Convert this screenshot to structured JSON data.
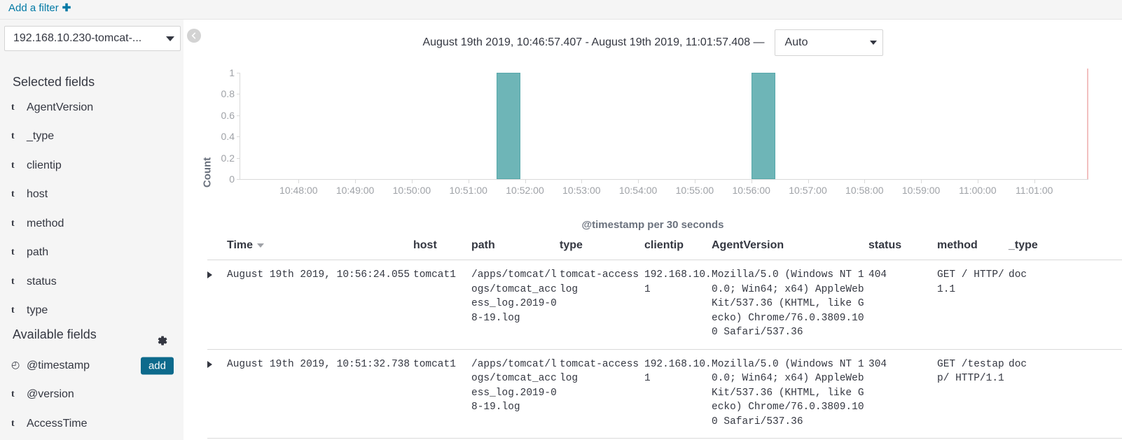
{
  "filter_bar": {
    "add_filter_label": "Add a filter",
    "plus_glyph": "✚"
  },
  "sidebar": {
    "index_pattern": "192.168.10.230-tomcat-...",
    "selected_fields_title": "Selected fields",
    "available_fields_title": "Available fields",
    "add_button_label": "add",
    "selected_fields": [
      {
        "type": "t",
        "name": "AgentVersion"
      },
      {
        "type": "t",
        "name": "_type"
      },
      {
        "type": "t",
        "name": "clientip"
      },
      {
        "type": "t",
        "name": "host"
      },
      {
        "type": "t",
        "name": "method"
      },
      {
        "type": "t",
        "name": "path"
      },
      {
        "type": "t",
        "name": "status"
      },
      {
        "type": "t",
        "name": "type"
      }
    ],
    "available_fields": [
      {
        "type": "⊘",
        "name": "@timestamp",
        "has_add": true
      },
      {
        "type": "t",
        "name": "@version",
        "has_add": false
      },
      {
        "type": "t",
        "name": "AccessTime",
        "has_add": false
      }
    ]
  },
  "toolbar": {
    "time_range": "August 19th 2019, 10:46:57.407 - August 19th 2019, 11:01:57.408 —",
    "interval": "Auto"
  },
  "chart_data": {
    "type": "bar",
    "title": "",
    "xlabel": "@timestamp per 30 seconds",
    "ylabel": "Count",
    "ylim": [
      0,
      1
    ],
    "yticks": [
      "1",
      "0.8",
      "0.6",
      "0.4",
      "0.2",
      "0"
    ],
    "ytick_values": [
      1,
      0.8,
      0.6,
      0.4,
      0.2,
      0
    ],
    "xticks": [
      "10:48:00",
      "10:49:00",
      "10:50:00",
      "10:51:00",
      "10:52:00",
      "10:53:00",
      "10:54:00",
      "10:55:00",
      "10:56:00",
      "10:57:00",
      "10:58:00",
      "10:59:00",
      "11:00:00",
      "11:01:00"
    ],
    "bars": [
      {
        "time": "10:51:30",
        "value": 1
      },
      {
        "time": "10:56:00",
        "value": 1
      }
    ],
    "bar_color": "#6eb5b7",
    "now_marker_color": "#f2c0c0",
    "grid": false,
    "legend": "none"
  },
  "table": {
    "columns": [
      "Time",
      "host",
      "path",
      "type",
      "clientip",
      "AgentVersion",
      "status",
      "method",
      "_type"
    ],
    "sorted_column": "Time",
    "rows": [
      {
        "time": "August 19th 2019, 10:56:24.055",
        "host": "tomcat1",
        "path": "/apps/tomcat/logs/tomcat_access_log.2019-08-19.log",
        "type": "tomcat-accesslog",
        "clientip": "192.168.10.1",
        "AgentVersion": "Mozilla/5.0 (Windows NT 10.0; Win64; x64) AppleWebKit/537.36 (KHTML, like Gecko) Chrome/76.0.3809.100 Safari/537.36",
        "status": "404",
        "method": "GET / HTTP/1.1",
        "_type": "doc"
      },
      {
        "time": "August 19th 2019, 10:51:32.738",
        "host": "tomcat1",
        "path": "/apps/tomcat/logs/tomcat_access_log.2019-08-19.log",
        "type": "tomcat-accesslog",
        "clientip": "192.168.10.1",
        "AgentVersion": "Mozilla/5.0 (Windows NT 10.0; Win64; x64) AppleWebKit/537.36 (KHTML, like Gecko) Chrome/76.0.3809.100 Safari/537.36",
        "status": "304",
        "method": "GET /testapp/ HTTP/1.1",
        "_type": "doc"
      }
    ]
  }
}
